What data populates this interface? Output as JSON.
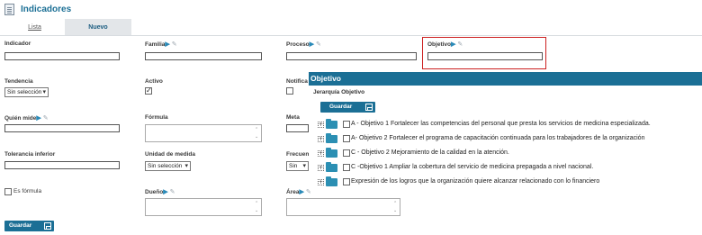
{
  "header": {
    "title": "Indicadores"
  },
  "tabs": [
    {
      "label": "Lista"
    },
    {
      "label": "Nuevo"
    }
  ],
  "form": {
    "indicador": {
      "label": "Indicador",
      "value": ""
    },
    "familia": {
      "label": "Familia",
      "value": ""
    },
    "proceso": {
      "label": "Proceso",
      "value": ""
    },
    "objetivo": {
      "label": "Objetivo",
      "value": ""
    },
    "tendencia": {
      "label": "Tendencia",
      "selected": "Sin selección"
    },
    "activo": {
      "label": "Activo",
      "checked": true
    },
    "notificar": {
      "label": "Notifica",
      "checked": false
    },
    "quien_mide": {
      "label": "Quién mide",
      "value": ""
    },
    "formula": {
      "label": "Fórmula",
      "value": ""
    },
    "meta": {
      "label": "Meta",
      "value": ""
    },
    "tolerancia_inferior": {
      "label": "Tolerancia inferior",
      "value": ""
    },
    "unidad_medida": {
      "label": "Unidad de medida",
      "selected": "Sin selección"
    },
    "frecuencia": {
      "label": "Frecuen",
      "selected": "Sin selecc"
    },
    "es_formula": {
      "label": "Es fórmula",
      "checked": false
    },
    "dueno": {
      "label": "Dueño",
      "value": ""
    },
    "area": {
      "label": "Área",
      "value": ""
    }
  },
  "save_label": "Guardar",
  "popup": {
    "title": "Objetivo",
    "subtitle": "Jerarquía Objetivo",
    "save_label": "Guardar",
    "items": [
      {
        "text": "A - Objetivo 1 Fortalecer las competencias del personal que presta los servicios de medicina especializada."
      },
      {
        "text": "A- Objetivo 2 Fortalecer el programa de capacitación continuada para los trabajadores de la organización"
      },
      {
        "text": "C - Objetivo 2 Mejoramiento de la calidad en la atención."
      },
      {
        "text": "C -Objetivo 1 Ampliar la cobertura del servicio de medicina prepagada a nivel nacional."
      },
      {
        "text": "Expresión de los logros que la organización quiere alcanzar relacionado con lo financiero"
      }
    ]
  },
  "colors": {
    "accent": "#1b6f95",
    "highlight_border": "#cc2020",
    "folder": "#2b8fb3"
  },
  "icons": {
    "header": "list-icon",
    "label_arrow": "arrow-right-icon",
    "label_pin": "pencil-icon",
    "save": "floppy-disk-icon",
    "tree_expand": "plus-icon",
    "tree_node": "folder-icon"
  }
}
